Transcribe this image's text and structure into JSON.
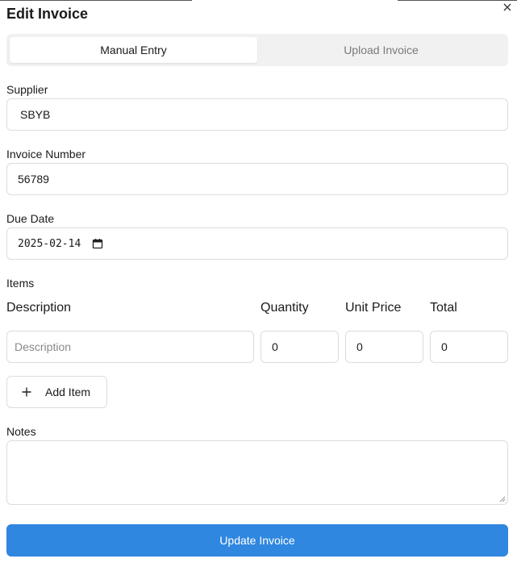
{
  "dialog": {
    "title": "Edit Invoice"
  },
  "tabs": [
    {
      "label": "Manual Entry",
      "active": true
    },
    {
      "label": "Upload Invoice",
      "active": false
    }
  ],
  "form": {
    "supplier": {
      "label": "Supplier",
      "value": "SBYB"
    },
    "invoice_number": {
      "label": "Invoice Number",
      "value": "56789"
    },
    "due_date": {
      "label": "Due Date",
      "value": "2025-02-14"
    },
    "items": {
      "label": "Items",
      "columns": [
        "Description",
        "Quantity",
        "Unit Price",
        "Total"
      ],
      "rows": [
        {
          "description_placeholder": "Description",
          "quantity": "0",
          "unit_price": "0",
          "total": "0"
        }
      ],
      "add_label": "Add Item"
    },
    "notes": {
      "label": "Notes",
      "value": ""
    },
    "submit_label": "Update Invoice"
  },
  "colors": {
    "accent": "#2f87e0",
    "border": "#dcdcdc",
    "tab_bg": "#f1f1f1"
  },
  "icons": {
    "close": "close-icon",
    "calendar": "calendar-icon",
    "add": "plus-icon"
  }
}
